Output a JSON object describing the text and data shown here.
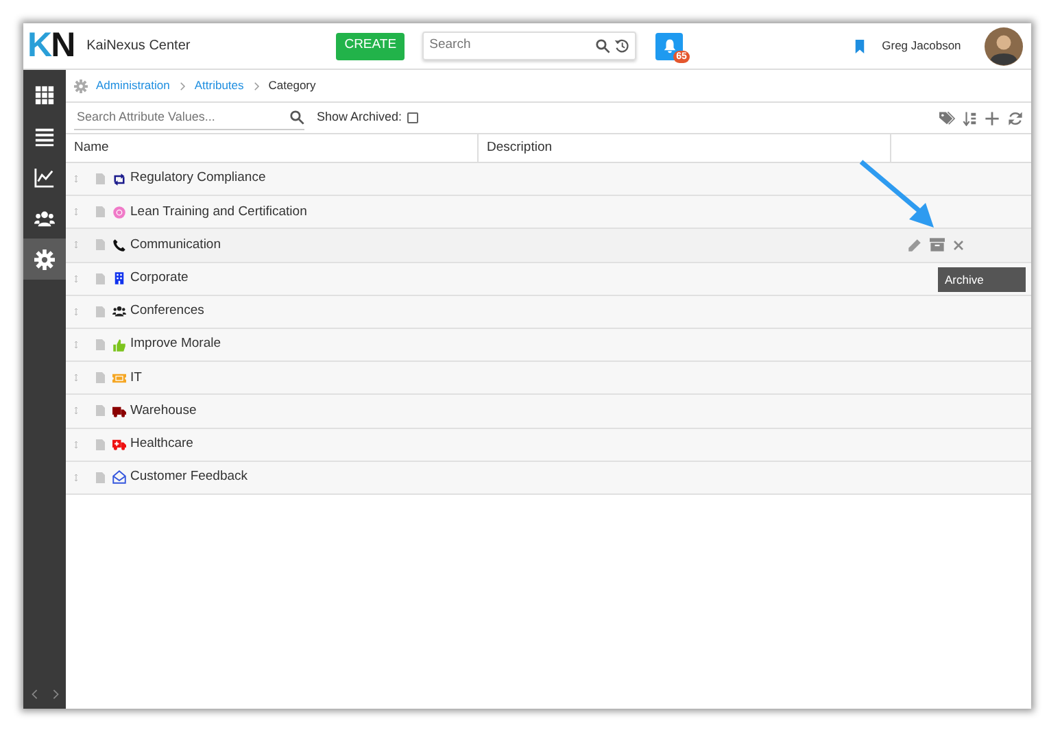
{
  "header": {
    "logo": [
      {
        "text": "K",
        "color": "#2a9fd8"
      },
      {
        "text": "N",
        "color": "#151515"
      }
    ],
    "app_name": "KaiNexus Center",
    "create_button": "CREATE",
    "search": {
      "placeholder": "Search"
    },
    "notifications": {
      "count": "65"
    },
    "user_name": "Greg Jacobson"
  },
  "sidebar": {
    "items": [
      {
        "kind": "apps",
        "selected": false
      },
      {
        "kind": "list",
        "selected": false
      },
      {
        "kind": "chart",
        "selected": false
      },
      {
        "kind": "users",
        "selected": false
      },
      {
        "kind": "settings",
        "selected": true
      }
    ]
  },
  "breadcrumb": [
    {
      "label": "Administration",
      "link": true
    },
    {
      "label": "Attributes",
      "link": true
    },
    {
      "label": "Category",
      "link": false
    }
  ],
  "toolbar": {
    "search": {
      "placeholder": "Search Attribute Values..."
    },
    "show_archived": {
      "label": "Show Archived:",
      "checked": false
    }
  },
  "table": {
    "columns": [
      "Name",
      "Description"
    ],
    "rows": [
      {
        "name": "Regulatory Compliance",
        "kind": "retweet",
        "color": "#1a1a8c",
        "hovered": false
      },
      {
        "name": "Lean Training and Certification",
        "kind": "circle",
        "color": "#f07ac8",
        "hovered": false
      },
      {
        "name": "Communication",
        "kind": "phone",
        "color": "#111111",
        "hovered": true
      },
      {
        "name": "Corporate",
        "kind": "building",
        "color": "#1133ee",
        "hovered": false
      },
      {
        "name": "Conferences",
        "kind": "users",
        "color": "#222222",
        "hovered": false
      },
      {
        "name": "Improve Morale",
        "kind": "thumb",
        "color": "#7cc41e",
        "hovered": false
      },
      {
        "name": "IT",
        "kind": "ticket",
        "color": "#f5a623",
        "hovered": false
      },
      {
        "name": "Warehouse",
        "kind": "truck",
        "color": "#8b0000",
        "hovered": false
      },
      {
        "name": "Healthcare",
        "kind": "ambulance",
        "color": "#ee1111",
        "hovered": false
      },
      {
        "name": "Customer Feedback",
        "kind": "envelope",
        "color": "#3355dd",
        "hovered": false
      }
    ]
  },
  "tooltip": "Archive"
}
